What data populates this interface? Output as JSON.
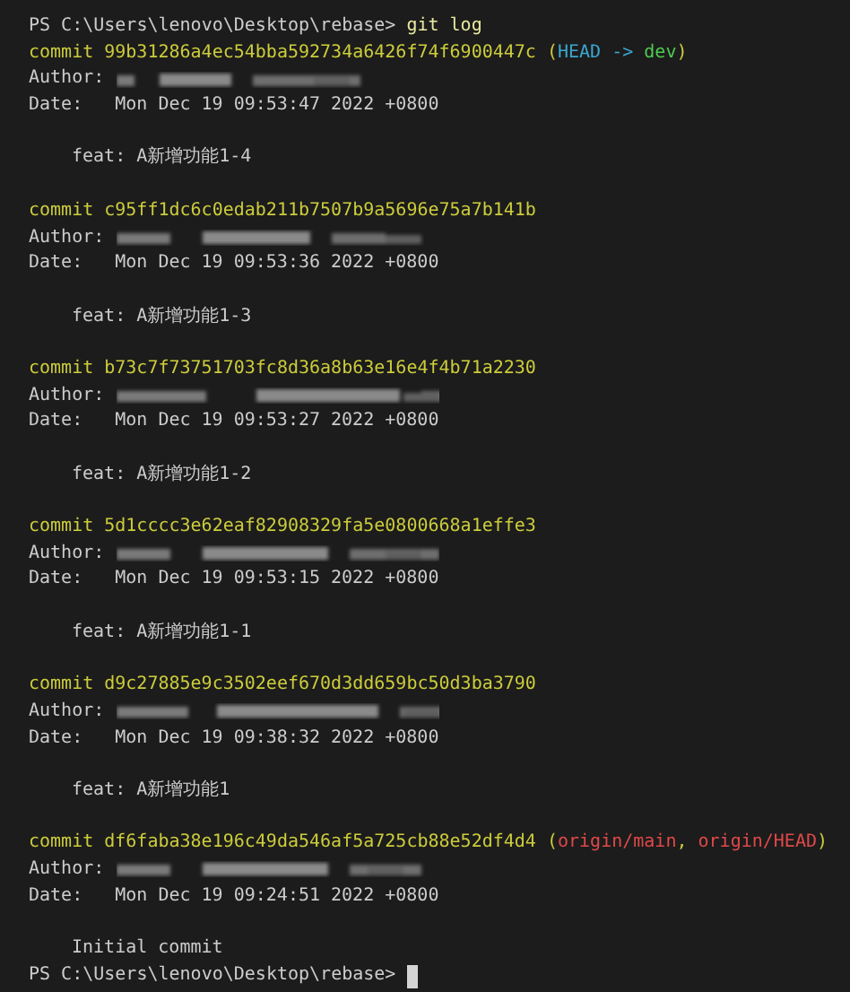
{
  "prompt": {
    "path": "PS C:\\Users\\lenovo\\Desktop\\rebase>",
    "command": "git log"
  },
  "commits": [
    {
      "label": "commit",
      "hash": "99b31286a4ec54bba592734a6426f74f6900447c",
      "decoration": [
        {
          "text": "(",
          "color": "#cccc3c"
        },
        {
          "text": "HEAD -> ",
          "color": "#3ba7d0"
        },
        {
          "text": "dev",
          "color": "#4ec94e"
        },
        {
          "text": ")",
          "color": "#cccc3c"
        }
      ],
      "author_label": "Author:",
      "date_label": "Date:",
      "date": "Mon Dec 19 09:53:47 2022 +0800",
      "message": "feat: A新增功能1-4"
    },
    {
      "label": "commit",
      "hash": "c95ff1dc6c0edab211b7507b9a5696e75a7b141b",
      "author_label": "Author:",
      "date_label": "Date:",
      "date": "Mon Dec 19 09:53:36 2022 +0800",
      "message": "feat: A新增功能1-3"
    },
    {
      "label": "commit",
      "hash": "b73c7f73751703fc8d36a8b63e16e4f4b71a2230",
      "author_label": "Author:",
      "date_label": "Date:",
      "date": "Mon Dec 19 09:53:27 2022 +0800",
      "message": "feat: A新增功能1-2"
    },
    {
      "label": "commit",
      "hash": "5d1cccc3e62eaf82908329fa5e0800668a1effe3",
      "author_label": "Author:",
      "date_label": "Date:",
      "date": "Mon Dec 19 09:53:15 2022 +0800",
      "message": "feat: A新增功能1-1"
    },
    {
      "label": "commit",
      "hash": "d9c27885e9c3502eef670d3dd659bc50d3ba3790",
      "author_label": "Author:",
      "date_label": "Date:",
      "date": "Mon Dec 19 09:38:32 2022 +0800",
      "message": "feat: A新增功能1"
    },
    {
      "label": "commit",
      "hash": "df6faba38e196c49da546af5a725cb88e52df4d4",
      "decoration": [
        {
          "text": "(",
          "color": "#cccc3c"
        },
        {
          "text": "origin/main",
          "color": "#e04848"
        },
        {
          "text": ", ",
          "color": "#cccc3c"
        },
        {
          "text": "origin/HEAD",
          "color": "#e04848"
        },
        {
          "text": ")",
          "color": "#cccc3c"
        }
      ],
      "author_label": "Author:",
      "date_label": "Date:",
      "date": "Mon Dec 19 09:24:51 2022 +0800",
      "message": "Initial commit"
    }
  ],
  "final_prompt": {
    "path": "PS C:\\Users\\lenovo\\Desktop\\rebase>"
  }
}
